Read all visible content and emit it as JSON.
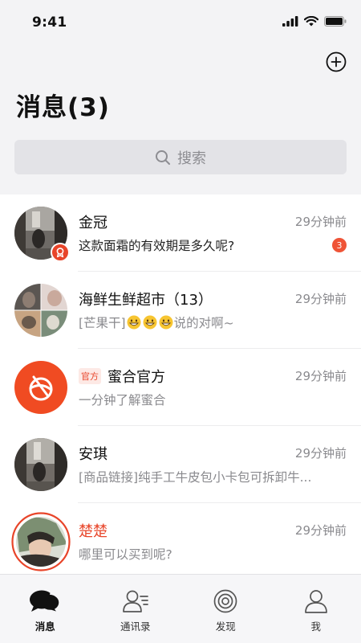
{
  "status_bar": {
    "time": "9:41"
  },
  "header": {
    "title": "消息(3)"
  },
  "search": {
    "placeholder": "搜索"
  },
  "conversations": [
    {
      "name": "金冠",
      "time": "29分钟前",
      "preview": "这款面霜的有效期是多久呢?",
      "unread": "3",
      "avatar": "photo-with-red-ribbon-badge"
    },
    {
      "name": "海鲜生鲜超市（13）",
      "time": "29分钟前",
      "preview_prefix": "[芒果干]",
      "preview_suffix": "说的对啊~",
      "emoji": [
        "grinning-emoji",
        "grinning-emoji",
        "grinning-emoji"
      ],
      "avatar": "group-photo-grid"
    },
    {
      "tag": "官方",
      "name": "蜜合官方",
      "time": "29分钟前",
      "preview": "一分钟了解蜜合",
      "avatar": "mihe-official-logo"
    },
    {
      "name": "安琪",
      "time": "29分钟前",
      "preview": "[商品链接]纯手工牛皮包小卡包可拆卸牛...",
      "avatar": "photo"
    },
    {
      "name": "楚楚",
      "time": "29分钟前",
      "preview": "哪里可以买到呢?",
      "avatar": "photo-with-red-ring"
    }
  ],
  "tabs": [
    {
      "label": "消息",
      "icon": "chat-bubbles-icon",
      "active": true
    },
    {
      "label": "通讯录",
      "icon": "contacts-icon",
      "active": false
    },
    {
      "label": "发现",
      "icon": "discover-icon",
      "active": false
    },
    {
      "label": "我",
      "icon": "profile-icon",
      "active": false
    }
  ],
  "colors": {
    "accent": "#e8452a",
    "badge": "#ef5437",
    "background": "#f3f3f5"
  }
}
